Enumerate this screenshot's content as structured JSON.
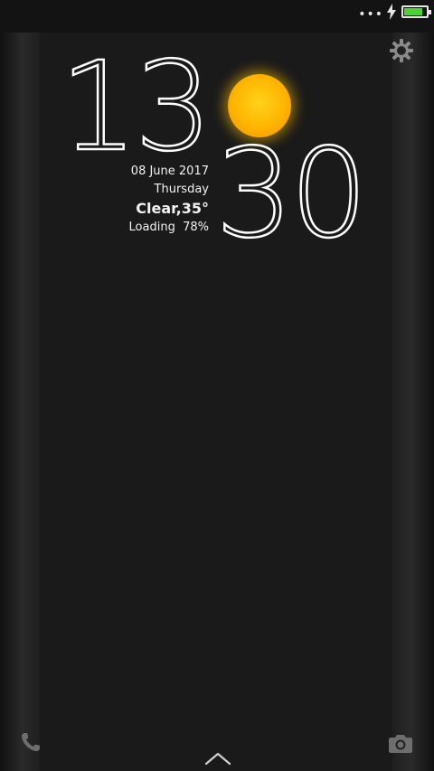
{
  "status_bar": {
    "overflow_dots": "•••",
    "battery_level": 0.85,
    "battery_color": "#4cd137",
    "charging": true
  },
  "clock": {
    "hour": "13",
    "minute": "30"
  },
  "info": {
    "date": "08 June 2017",
    "weekday": "Thursday",
    "weather": "Clear,35°",
    "loading": "Loading  78%"
  },
  "icons": {
    "settings": "gear-icon",
    "weather": "sun-icon",
    "phone": "phone-icon",
    "camera": "camera-icon",
    "unlock": "chevron-up-icon"
  },
  "colors": {
    "sun": "#ffb400",
    "text": "#ffffff",
    "background": "#1a1a1a"
  }
}
